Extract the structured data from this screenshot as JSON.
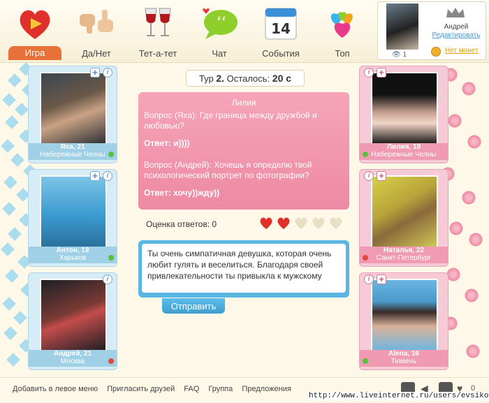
{
  "nav": {
    "items": [
      {
        "label": "Игра",
        "icon": "heart-play-icon"
      },
      {
        "label": "Да/Нет",
        "icon": "thumbs-icon"
      },
      {
        "label": "Тет-а-тет",
        "icon": "wine-glasses-icon"
      },
      {
        "label": "Чат",
        "icon": "chat-bubble-icon"
      },
      {
        "label": "События",
        "icon": "calendar-icon"
      },
      {
        "label": "Топ",
        "icon": "top-hearts-icon"
      }
    ],
    "calendar_day": "14"
  },
  "profile": {
    "name": "Андрей",
    "edit_label": "Редактировать",
    "views": "1",
    "no_money_label": "Нет монет"
  },
  "left_cards": [
    {
      "name": "Яха, 21",
      "city": "Набережные Челны",
      "online": true
    },
    {
      "name": "Антон, 19",
      "city": "Харьков",
      "online": true
    },
    {
      "name": "Андрей, 21",
      "city": "Москва",
      "online": false
    }
  ],
  "right_cards": [
    {
      "name": "Лилия, 18",
      "city": "Набережные Челны",
      "online": true
    },
    {
      "name": "Наталья, 22",
      "city": "Санкт-Петербург",
      "online": false
    },
    {
      "name": "Alena, 16",
      "city": "Тюмень",
      "online": true
    }
  ],
  "round": {
    "label": "Тур",
    "number": "2.",
    "remaining_label": "Осталось:",
    "remaining": "20 с"
  },
  "question_box": {
    "host": "Лилия",
    "q1": "Вопрос (Яха): Где граница между дружбой и любовью?",
    "a1": "Ответ: и))))",
    "q2": "Вопрос (Андрей): Хочешь я определю твой психологический портрет по фотографии?",
    "a2": "Ответ: хочу))жду))"
  },
  "rating": {
    "label": "Оценка ответов: 0",
    "hearts_filled": 2,
    "hearts_total": 5
  },
  "answer": {
    "text": "Ты очень симпатичная девушка, которая очень любит гулять и веселиться. Благодаря своей привлекательности ты привыкла к мужскому",
    "send_label": "Отправить"
  },
  "footer": {
    "links": [
      "Добавить в левое меню",
      "Пригласить друзей",
      "FAQ",
      "Группа",
      "Предложения"
    ],
    "url": "http://www.liveinternet.ru/users/evsikoff/",
    "likes": "0"
  },
  "colors": {
    "accent": "#e8713a",
    "blue": "#5ab7e4",
    "pink": "#ed8aa3"
  }
}
